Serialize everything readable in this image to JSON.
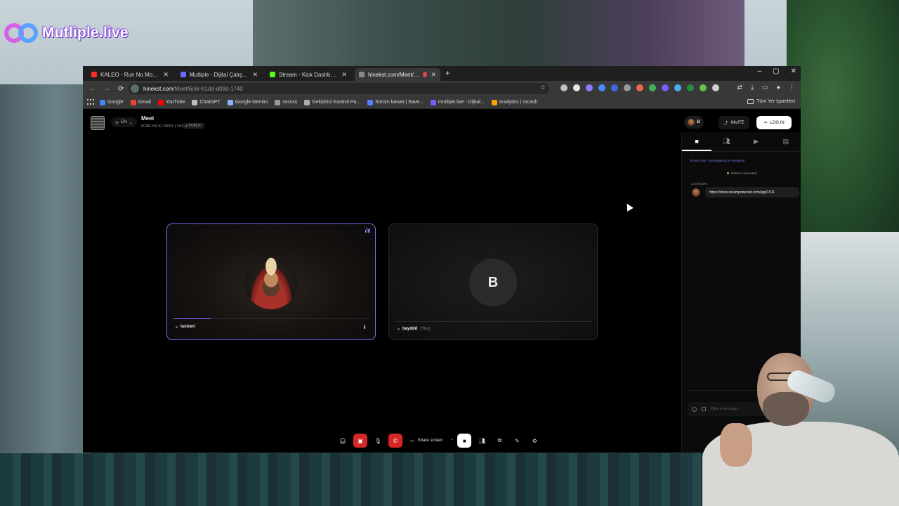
{
  "overlay": {
    "brand": "Mutliple.live"
  },
  "browser": {
    "tabs": [
      {
        "title": "KALEO - Run No More (Official",
        "favicon_color": "#ff2d2d",
        "active": false
      },
      {
        "title": "Mutliple - Dijital Çalışma Alanın",
        "favicon_color": "#6b6bff",
        "active": false
      },
      {
        "title": "Stream - Kick Dashboard",
        "favicon_color": "#53fc18",
        "active": false
      },
      {
        "title": "hinekst.com/Meet/6c6r-h1",
        "favicon_color": "#8a8a8a",
        "active": true
      }
    ],
    "new_tab_icon": "+",
    "window_controls": {
      "minimize": "–",
      "maximize": "▢",
      "close": "✕"
    },
    "nav": {
      "back": "←",
      "forward": "→",
      "reload": "⟳"
    },
    "address": {
      "host": "hinekst.com",
      "path": "/Meet/6c6r-h1dd-d09d-1740"
    },
    "bookmarks": [
      {
        "label": "Google",
        "icon_color": "#4285f4"
      },
      {
        "label": "Gmail",
        "icon_color": "#ea4335"
      },
      {
        "label": "YouTube",
        "icon_color": "#ff0000"
      },
      {
        "label": "ChatGPT",
        "icon_color": "#bfbfbf"
      },
      {
        "label": "Google Gemini",
        "icon_color": "#8ab4f8"
      },
      {
        "label": "ssssss",
        "icon_color": "#9a9a9a"
      },
      {
        "label": "Geliştirici Kontrol Pa...",
        "icon_color": "#b0b0b0"
      },
      {
        "label": "Sürüm kanalı | Save...",
        "icon_color": "#5b7cff"
      },
      {
        "label": "mutliple.live - Dijital...",
        "icon_color": "#7a5cff"
      },
      {
        "label": "Analytics | rocash",
        "icon_color": "#f4a300"
      }
    ],
    "all_bookmarks": "Tüm Yer İşaretleri"
  },
  "meet": {
    "header": {
      "lang": "EN",
      "title": "Meet",
      "room_id": "6C6R-H1DD-D09D-1740",
      "badge": "PUBLIC",
      "host_initial": "B",
      "invite_label": "INVITE",
      "login_label": "LOG IN"
    },
    "tiles": [
      {
        "name": "lastceri",
        "speaking": true,
        "audio_level": 0.19
      },
      {
        "initial": "B",
        "name": "bayddd",
        "you_label": "(You)"
      }
    ],
    "controls": {
      "share_label": "Share screen"
    },
    "chat": {
      "banner": "Room chat · messages go to everyone",
      "system_message": "lastceri connected",
      "messages": [
        {
          "author": "LASTCERI",
          "text": "https://store.steampowered.com/app/1911"
        }
      ],
      "input_placeholder": "Write a message..."
    }
  },
  "colors": {
    "accent": "#7a6cf0",
    "danger": "#d62727",
    "link": "#6f7cf2"
  }
}
